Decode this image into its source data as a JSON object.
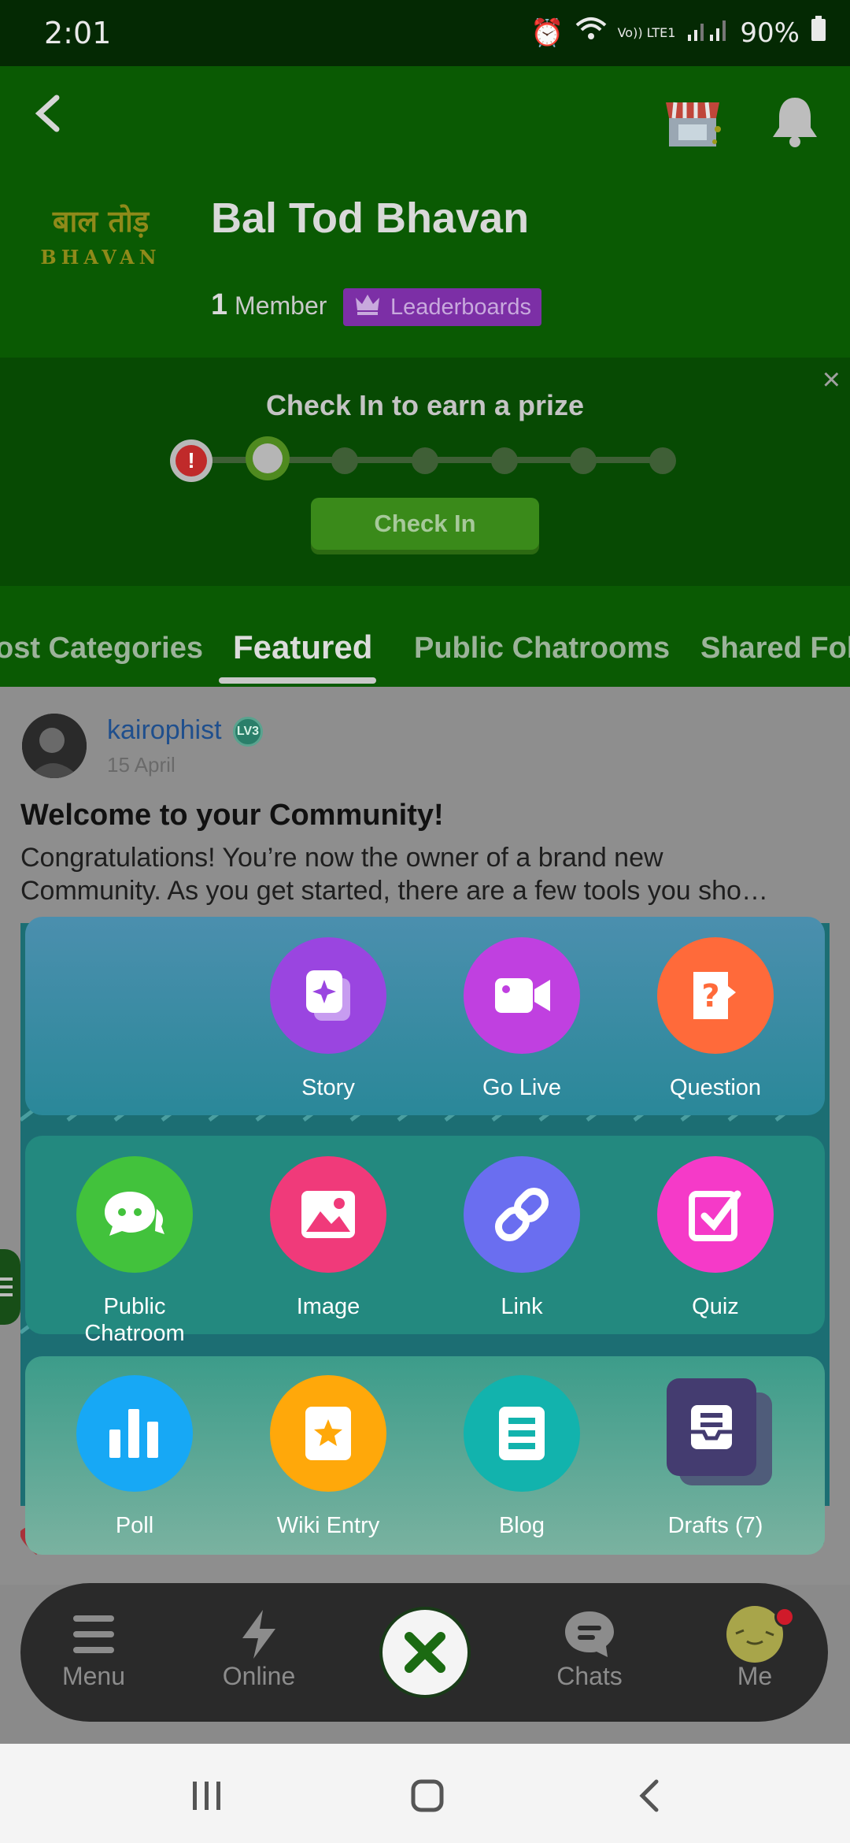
{
  "status_bar": {
    "time": "2:01",
    "battery": "90%",
    "network": "Vo)) LTE1"
  },
  "community": {
    "name": "Bal Tod Bhavan",
    "logo_hindi": "बाल तोड़",
    "logo_english": "BHAVAN",
    "member_count": "1",
    "member_label": "Member",
    "leaderboards_label": "Leaderboards"
  },
  "checkin": {
    "title": "Check In to earn a prize",
    "button_label": "Check In",
    "close_label": "×",
    "steps_total": 7,
    "current_step": 2
  },
  "tabs": [
    {
      "label": "ost Categories"
    },
    {
      "label": "Featured",
      "active": true
    },
    {
      "label": "Public Chatrooms"
    },
    {
      "label": "Shared Fol"
    }
  ],
  "post": {
    "author": "kairophist",
    "level": "LV3",
    "date": "15 April",
    "title": "Welcome to your Community!",
    "body_line1": "Congratulations! You’re now the owner of a brand new",
    "body_line2": "Community. As you get started, there are a few tools you sho…"
  },
  "create_menu": {
    "row1": [
      {
        "label": "Story",
        "icon": "story-icon",
        "color": "#9a45e0"
      },
      {
        "label": "Go Live",
        "icon": "video-camera-icon",
        "color": "#c040e0"
      },
      {
        "label": "Question",
        "icon": "question-icon",
        "color": "#ff6a3a"
      }
    ],
    "row2": [
      {
        "label": "Public\nChatroom",
        "icon": "chat-bubbles-icon",
        "color": "#42c23c"
      },
      {
        "label": "Image",
        "icon": "image-icon",
        "color": "#f03a7a"
      },
      {
        "label": "Link",
        "icon": "link-icon",
        "color": "#6a6ef0"
      },
      {
        "label": "Quiz",
        "icon": "quiz-check-icon",
        "color": "#f53ac8"
      }
    ],
    "row3": [
      {
        "label": "Poll",
        "icon": "bar-chart-icon",
        "color": "#17a8f5"
      },
      {
        "label": "Wiki Entry",
        "icon": "star-card-icon",
        "color": "#ffa80a"
      },
      {
        "label": "Blog",
        "icon": "document-icon",
        "color": "#12b3ad"
      },
      {
        "label": "Drafts (7)",
        "icon": "drafts-tray-icon",
        "color": "#443c70"
      }
    ]
  },
  "bottom_nav": {
    "menu": "Menu",
    "online": "Online",
    "chats": "Chats",
    "me": "Me"
  }
}
